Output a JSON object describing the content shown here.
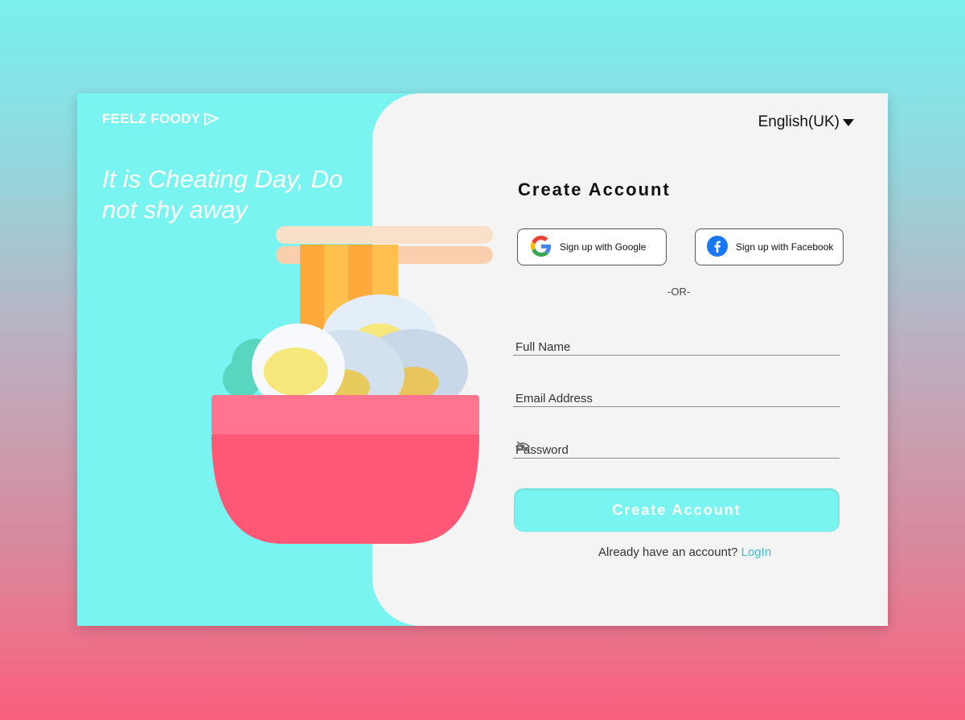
{
  "brand": {
    "name": "FEELZ FOODY"
  },
  "hero": {
    "tagline": "It is Cheating Day, Do not shy away"
  },
  "language": {
    "selected": "English(UK)"
  },
  "form": {
    "title": "Create Account",
    "google_label": "Sign up with Google",
    "facebook_label": "Sign up with Facebook",
    "divider": "-OR-",
    "full_name_label": "Full Name",
    "email_label": "Email Address",
    "password_label": "Password",
    "submit_label": "Create Account",
    "login_prompt": "Already have an account?",
    "login_link": "LogIn"
  },
  "colors": {
    "accent": "#7af4f0",
    "link": "#3fbcd1",
    "bowl": "#fb5a78"
  },
  "icons": {
    "logo": "pizza-slice-icon",
    "google": "google-icon",
    "facebook": "facebook-icon",
    "password_toggle": "eye-off-icon",
    "language": "caret-down-icon"
  }
}
